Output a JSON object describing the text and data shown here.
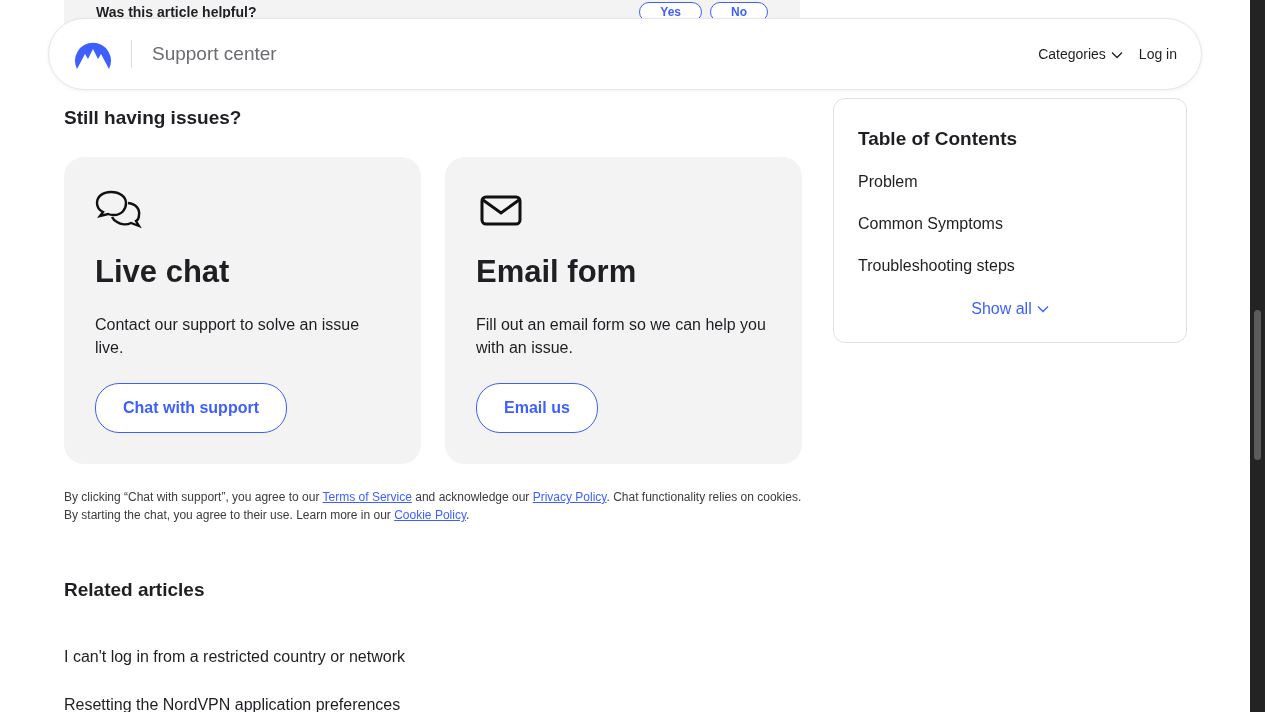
{
  "feedback": {
    "question": "Was this article helpful?",
    "buttons": [
      "Yes",
      "No"
    ]
  },
  "header": {
    "title": "Support center",
    "nav": [
      {
        "label": "Categories",
        "kind": "dropdown"
      },
      {
        "label": "Log in",
        "kind": "link"
      }
    ]
  },
  "support": {
    "heading": "Still having issues?",
    "cards": [
      {
        "kind": "chat",
        "title": "Live chat",
        "text": "Contact our support to solve an issue live.",
        "button": "Chat with support"
      },
      {
        "kind": "email",
        "title": "Email form",
        "text": "Fill out an email form so we can help you with an issue.",
        "button": "Email us"
      }
    ],
    "disclaimer": [
      {
        "text": "By clicking “Chat with support”, you agree to our "
      },
      {
        "text": "Terms of Service",
        "link": true
      },
      {
        "text": " and acknowledge our "
      },
      {
        "text": "Privacy Policy",
        "link": true
      },
      {
        "text": ". Chat functionality relies on cookies. By starting the chat, you agree to their use. Learn more in our "
      },
      {
        "text": "Cookie Policy",
        "link": true
      },
      {
        "text": "."
      }
    ]
  },
  "related": {
    "heading": "Related articles",
    "items": [
      "I can't log in from a restricted country or network",
      "Resetting the NordVPN application preferences"
    ]
  },
  "toc": {
    "title": "Table of Contents",
    "items": [
      "Problem",
      "Common Symptoms",
      "Troubleshooting steps"
    ],
    "show_all": "Show all"
  }
}
